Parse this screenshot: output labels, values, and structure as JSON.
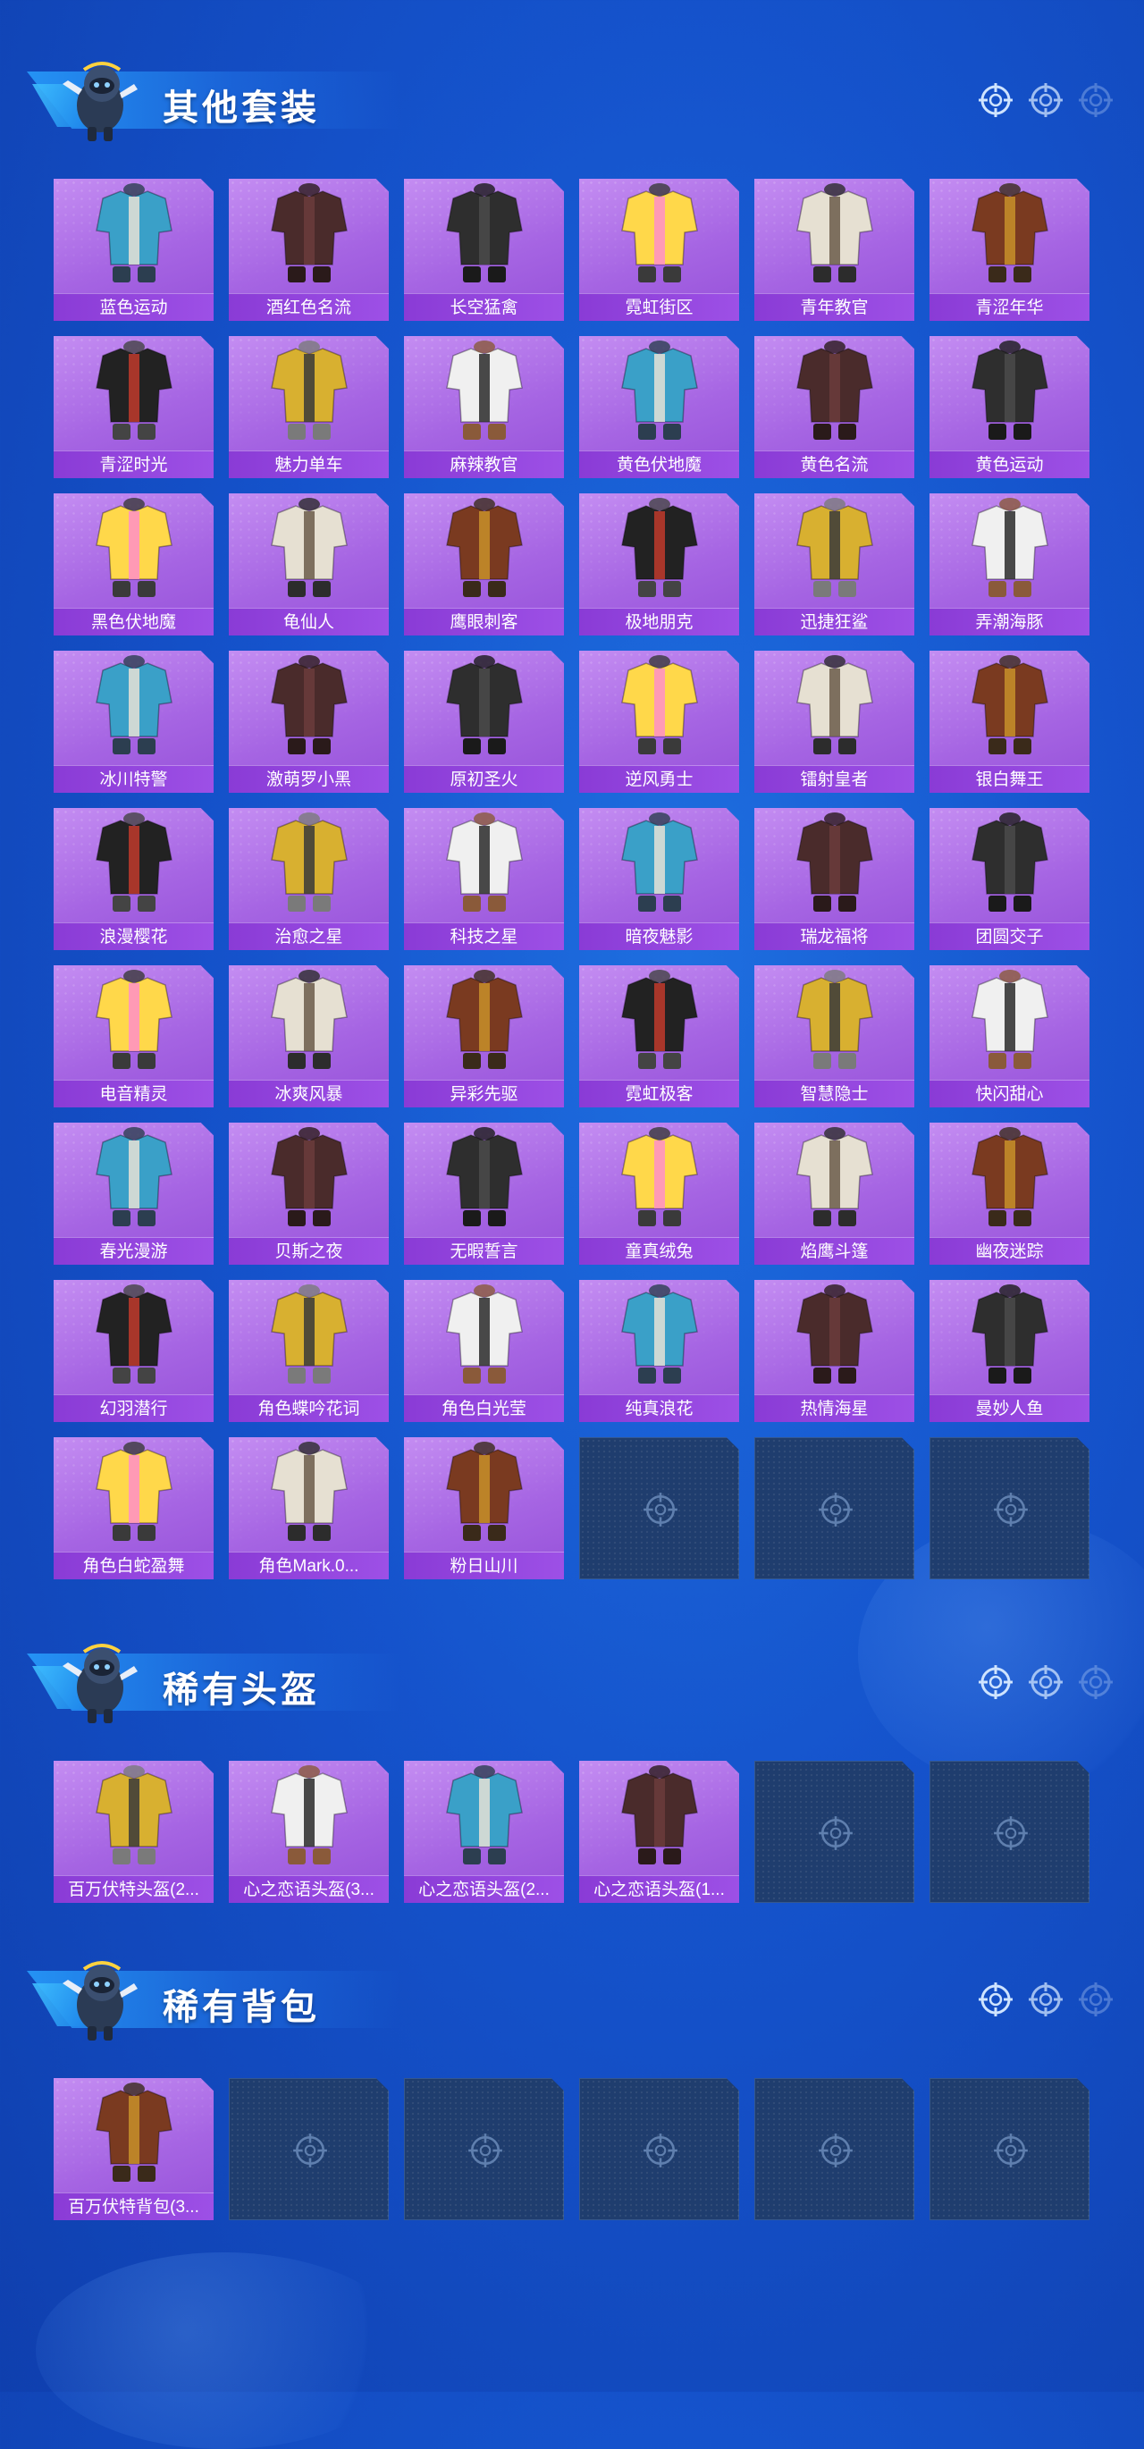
{
  "colors": {
    "background": "#1553cc",
    "card_purple": "#a665e3",
    "card_label": "#8a3bd6",
    "empty_slot": "#1f3d6e",
    "title_text": "#ffffff"
  },
  "sections": [
    {
      "title": "其他套装",
      "items": [
        {
          "name": "蓝色运动"
        },
        {
          "name": "酒红色名流"
        },
        {
          "name": "长空猛禽"
        },
        {
          "name": "霓虹街区"
        },
        {
          "name": "青年教官"
        },
        {
          "name": "青涩年华"
        },
        {
          "name": "青涩时光"
        },
        {
          "name": "魅力单车"
        },
        {
          "name": "麻辣教官"
        },
        {
          "name": "黄色伏地魔"
        },
        {
          "name": "黄色名流"
        },
        {
          "name": "黄色运动"
        },
        {
          "name": "黑色伏地魔"
        },
        {
          "name": "龟仙人"
        },
        {
          "name": "鹰眼刺客"
        },
        {
          "name": "极地朋克"
        },
        {
          "name": "迅捷狂鲨"
        },
        {
          "name": "弄潮海豚"
        },
        {
          "name": "冰川特警"
        },
        {
          "name": "激萌罗小黑"
        },
        {
          "name": "原初圣火"
        },
        {
          "name": "逆风勇士"
        },
        {
          "name": "镭射皇者"
        },
        {
          "name": "银白舞王"
        },
        {
          "name": "浪漫樱花"
        },
        {
          "name": "治愈之星"
        },
        {
          "name": "科技之星"
        },
        {
          "name": "暗夜魅影"
        },
        {
          "name": "瑞龙福将"
        },
        {
          "name": "团圆交子"
        },
        {
          "name": "电音精灵"
        },
        {
          "name": "冰爽风暴"
        },
        {
          "name": "异彩先驱"
        },
        {
          "name": "霓虹极客"
        },
        {
          "name": "智慧隐士"
        },
        {
          "name": "快闪甜心"
        },
        {
          "name": "春光漫游"
        },
        {
          "name": "贝斯之夜"
        },
        {
          "name": "无暇誓言"
        },
        {
          "name": "童真绒兔"
        },
        {
          "name": "焰鹰斗篷"
        },
        {
          "name": "幽夜迷踪"
        },
        {
          "name": "幻羽潜行"
        },
        {
          "name": "角色蝶吟花词"
        },
        {
          "name": "角色白光莹"
        },
        {
          "name": "纯真浪花"
        },
        {
          "name": "热情海星"
        },
        {
          "name": "曼妙人鱼"
        },
        {
          "name": "角色白蛇盈舞"
        },
        {
          "name": "角色Mark.0..."
        },
        {
          "name": "粉日山川"
        }
      ],
      "empty_slots": 3
    },
    {
      "title": "稀有头盔",
      "items": [
        {
          "name": "百万伏特头盔(2..."
        },
        {
          "name": "心之恋语头盔(3..."
        },
        {
          "name": "心之恋语头盔(2..."
        },
        {
          "name": "心之恋语头盔(1..."
        }
      ],
      "empty_slots": 2
    },
    {
      "title": "稀有背包",
      "items": [
        {
          "name": "百万伏特背包(3..."
        }
      ],
      "empty_slots": 5
    }
  ]
}
